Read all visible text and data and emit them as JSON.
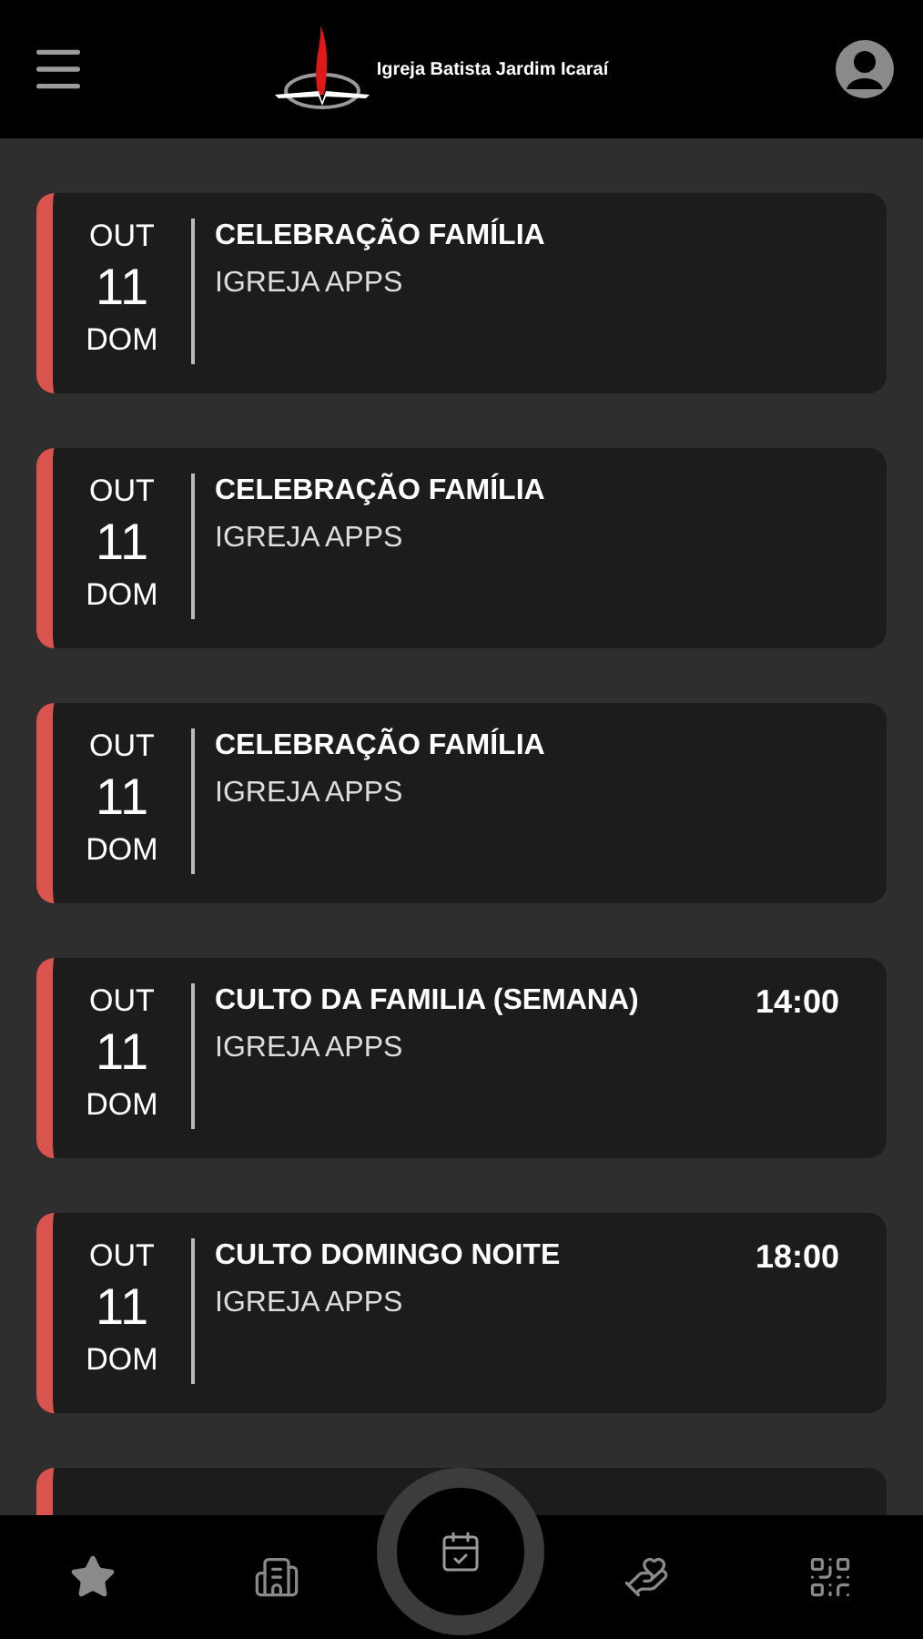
{
  "header": {
    "title": "Igreja Batista Jardim Icaraí"
  },
  "events": [
    {
      "month": "OUT",
      "day": "11",
      "weekday": "DOM",
      "title": "CELEBRAÇÃO FAMÍLIA",
      "subtitle": "IGREJA APPS"
    },
    {
      "month": "OUT",
      "day": "11",
      "weekday": "DOM",
      "title": "CELEBRAÇÃO FAMÍLIA",
      "subtitle": "IGREJA APPS"
    },
    {
      "month": "OUT",
      "day": "11",
      "weekday": "DOM",
      "title": "CELEBRAÇÃO FAMÍLIA",
      "subtitle": "IGREJA APPS"
    },
    {
      "month": "OUT",
      "day": "11",
      "weekday": "DOM",
      "title": "CULTO DA FAMILIA (SEMANA)",
      "subtitle": "IGREJA APPS",
      "time": "14:00"
    },
    {
      "month": "OUT",
      "day": "11",
      "weekday": "DOM",
      "title": "CULTO DOMINGO NOITE",
      "subtitle": "IGREJA APPS",
      "time": "18:00"
    },
    {
      "kind": "partial"
    }
  ],
  "nav": [
    {
      "kind": "star",
      "selected": false
    },
    {
      "kind": "building",
      "selected": false
    },
    {
      "kind": "calendar",
      "selected": true
    },
    {
      "kind": "donate",
      "selected": false
    },
    {
      "kind": "qr",
      "selected": false
    }
  ]
}
